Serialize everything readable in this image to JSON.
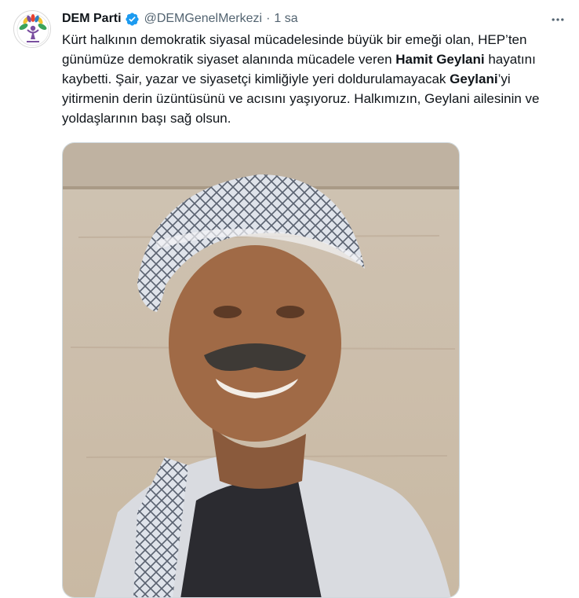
{
  "tweet": {
    "author_name": "DEM Parti",
    "handle": "@DEMGenelMerkezi",
    "separator": "·",
    "time": "1 sa",
    "verified_color": "#1d9bf0",
    "text_segments": [
      {
        "text": "Kürt halkının demokratik siyasal mücadelesinde büyük bir emeği olan, HEP’ten günümüze demokratik siyaset alanında mücadele veren ",
        "bold": false
      },
      {
        "text": "Hamit Geylani",
        "bold": true
      },
      {
        "text": " hayatını kaybetti. Şair, yazar ve siyasetçi kimliğiyle yeri doldurulamayacak ",
        "bold": false
      },
      {
        "text": "Geylani",
        "bold": true
      },
      {
        "text": "’yi yitirmenin derin üzüntüsünü ve acısını yaşıyoruz. Halkımızın, Geylani ailesinin ve yoldaşlarının başı sağ olsun.",
        "bold": false
      }
    ]
  },
  "icons": {
    "avatar": "dem-parti-logo",
    "verified": "verified-badge-icon",
    "more": "more-icon"
  }
}
